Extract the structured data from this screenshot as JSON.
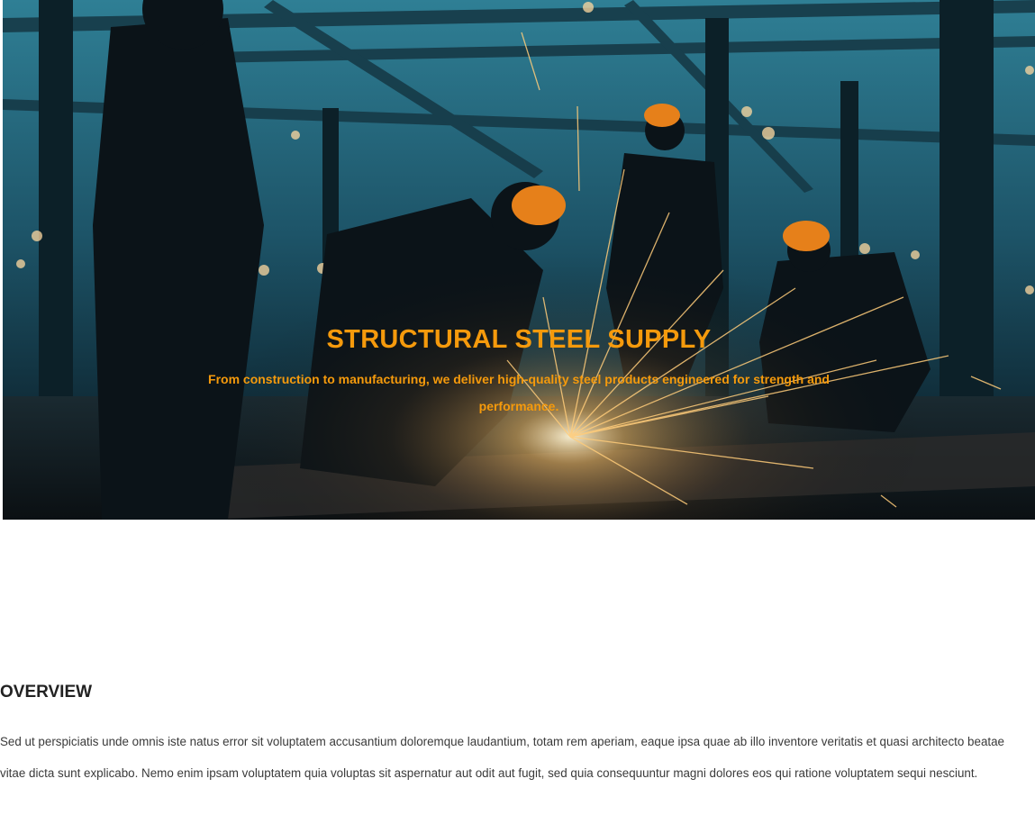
{
  "hero": {
    "image_description": "welding-workers-steel-structure-icon",
    "title": "STRUCTURAL STEEL SUPPLY",
    "subtitle": "From construction to manufacturing, we deliver high-quality steel products engineered for strength and performance."
  },
  "overview": {
    "title": "OVERVIEW",
    "body": "Sed ut perspiciatis unde omnis iste natus error sit voluptatem accusantium doloremque laudantium, totam rem aperiam, eaque ipsa quae ab illo inventore veritatis et quasi architecto beatae vitae dicta sunt explicabo. Nemo enim ipsam voluptatem quia voluptas sit aspernatur aut odit aut fugit, sed quia consequuntur magni dolores eos qui ratione voluptatem sequi nesciunt."
  },
  "colors": {
    "accent": "#f59a0c",
    "heading": "#222222",
    "body_text": "#3a3a3a",
    "hero_base": "#0d2a38"
  }
}
